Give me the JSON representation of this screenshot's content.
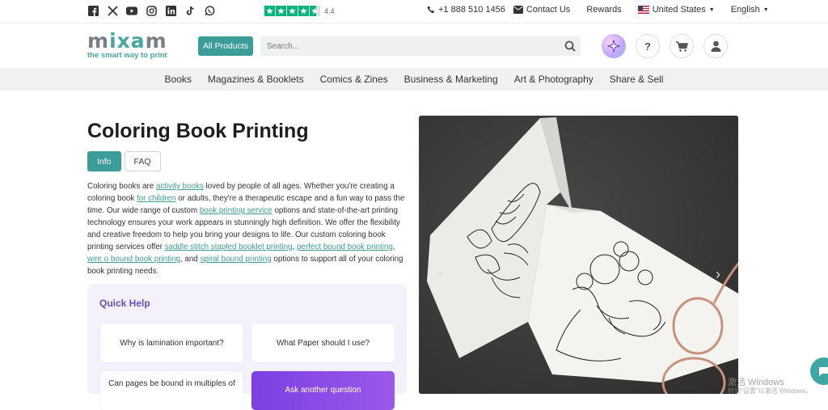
{
  "topbar": {
    "social_icons": [
      "facebook-icon",
      "x-icon",
      "youtube-icon",
      "instagram-icon",
      "linkedin-icon",
      "tiktok-icon",
      "whatsapp-icon"
    ],
    "rating": "4.4",
    "phone": "+1 888 510 1456",
    "contact": "Contact Us",
    "rewards": "Rewards",
    "country": "United States",
    "language": "English"
  },
  "header": {
    "logo_word": "mixam",
    "logo_tagline": "the smart way to print",
    "all_products": "All Products",
    "search_placeholder": "Search...",
    "help": "?"
  },
  "nav": {
    "items": [
      "Books",
      "Magazines & Booklets",
      "Comics & Zines",
      "Business & Marketing",
      "Art & Photography",
      "Share & Sell"
    ]
  },
  "main": {
    "title": "Coloring Book Printing",
    "tabs": [
      "Info",
      "FAQ"
    ],
    "desc": {
      "t1": "Coloring books are ",
      "l1": "activity books",
      "t2": " loved by people of all ages. Whether you're creating a coloring book ",
      "l2": "for children",
      "t3": " or adults, they're a therapeutic escape and a fun way to pass the time. Our wide range of custom ",
      "l3": "book printing service",
      "t4": " options and state-of-the-art printing technology ensures your work appears in stunningly high definition. We offer the flexibility and creative freedom to help you bring your designs to life. Our custom coloring book printing services offer ",
      "l4": "saddle stitch stapled booklet printing",
      "t5": ", ",
      "l5": "perfect bound book printing",
      "t6": ", ",
      "l6": "wire o bound book printing",
      "t7": ", and ",
      "l7": "spiral bound printing",
      "t8": " options to support all of your coloring book printing needs."
    }
  },
  "quick_help": {
    "heading": "Quick Help",
    "q1": "Why is lamination important?",
    "q2": "What Paper should I use?",
    "q3": "Can pages be bound in multiples of",
    "ask": "Ask another question"
  },
  "watermark": {
    "line1": "激活 Windows",
    "line2": "转到\"设置\"以激活 Windows。"
  },
  "colors": {
    "brand": "#3c9c98",
    "purple": "#6a4cc4",
    "trustpilot": "#00b67a"
  }
}
